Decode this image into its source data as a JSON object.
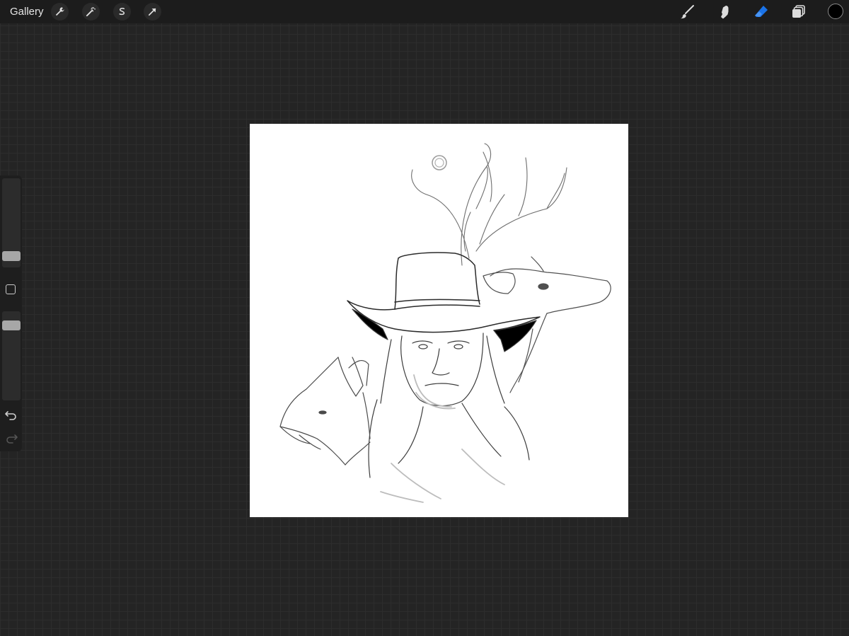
{
  "topbar": {
    "gallery_label": "Gallery",
    "left_tools": [
      {
        "name": "actions",
        "icon": "wrench-icon"
      },
      {
        "name": "adjustments",
        "icon": "magic-wand-icon"
      },
      {
        "name": "selection",
        "icon": "selection-s-icon"
      },
      {
        "name": "transform",
        "icon": "arrow-cursor-icon"
      }
    ],
    "right_tools": [
      {
        "name": "brush",
        "icon": "brush-icon",
        "active": false
      },
      {
        "name": "smudge",
        "icon": "smudge-finger-icon",
        "active": false
      },
      {
        "name": "eraser",
        "icon": "eraser-icon",
        "active": true
      },
      {
        "name": "layers",
        "icon": "layers-icon",
        "active": false
      }
    ],
    "current_color": "#000000",
    "active_color": "#1a73e8"
  },
  "sidebar": {
    "brush_size_icon": "slider-thumb",
    "opacity_icon": "slider-thumb",
    "modify_icon": "square-icon",
    "undo_icon": "undo-icon",
    "redo_icon": "redo-icon",
    "redo_enabled": false
  },
  "canvas": {
    "background": "#ffffff",
    "artwork": "sketch"
  }
}
